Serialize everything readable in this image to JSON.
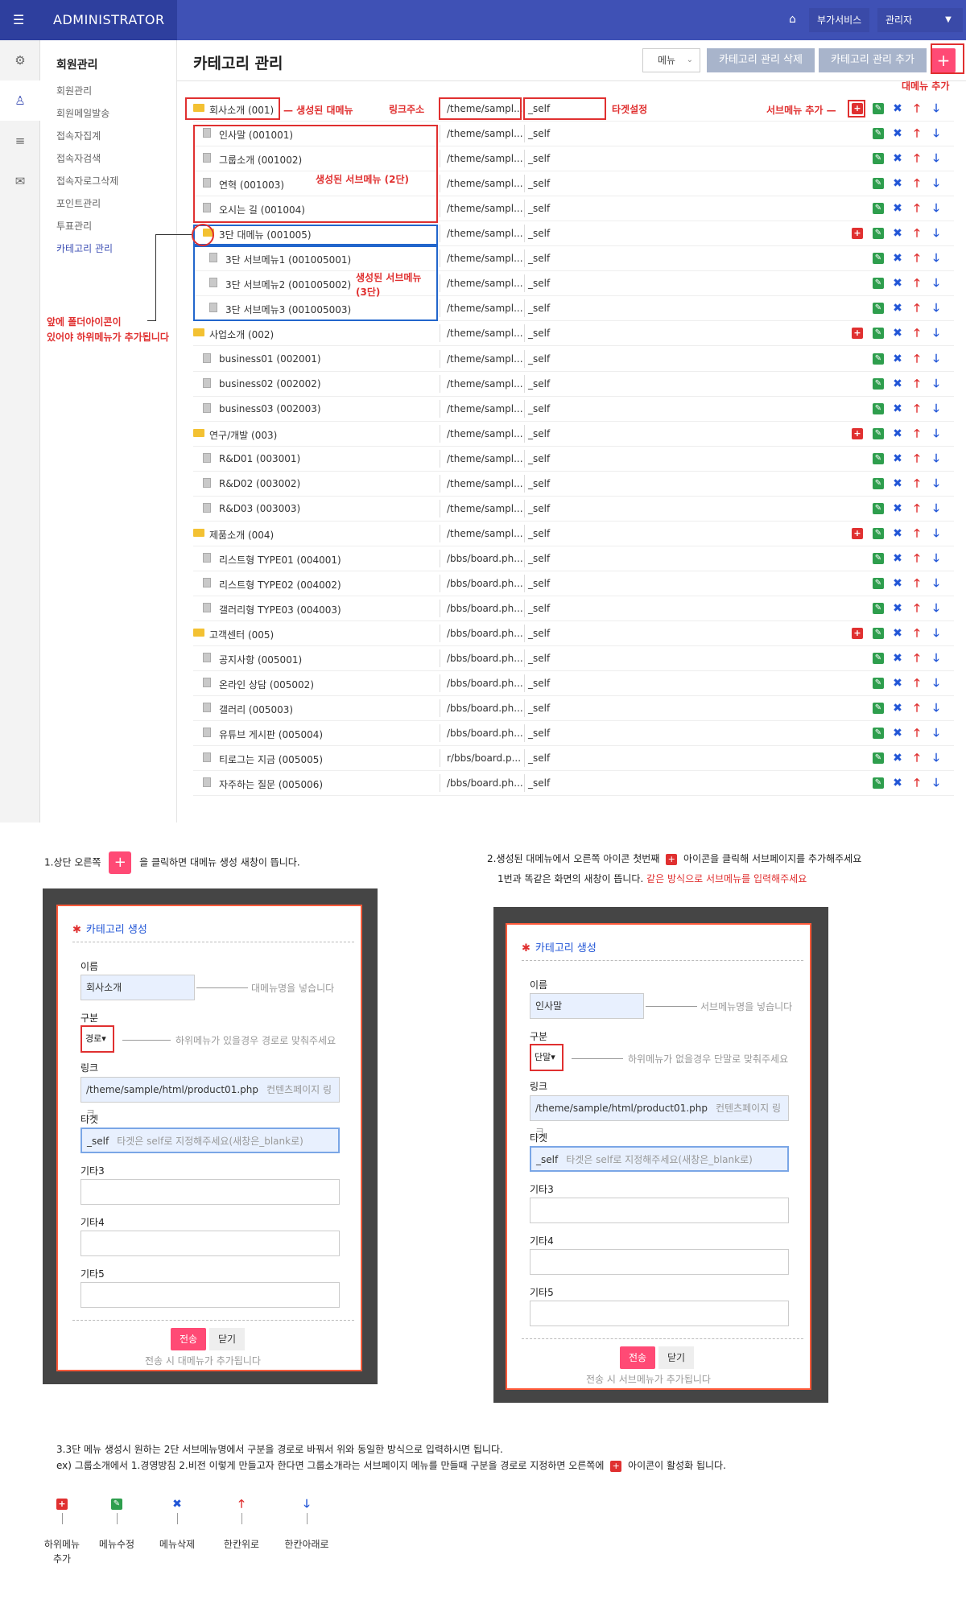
{
  "header": {
    "brand": "ADMINISTRATOR",
    "extra_services": "부가서비스",
    "admin": "관리자",
    "colors": {
      "topbar": "#3f51b5",
      "accent": "#ff4a75"
    }
  },
  "sidebar": {
    "title": "회원관리",
    "items": [
      "회원관리",
      "회원메일발송",
      "접속자집계",
      "접속자검색",
      "접속자로그삭제",
      "포인트관리",
      "투표관리",
      "카테고리 관리"
    ]
  },
  "toolbar": {
    "page_title": "카테고리 관리",
    "menu_select": "메뉴",
    "delete_btn": "카테고리 관리 삭제",
    "add_btn": "카테고리 관리 추가",
    "add_top_icon": "+"
  },
  "annotations": {
    "top_menu_add": "대메뉴 추가",
    "created_main": "— 생성된 대메뉴",
    "link_addr": "링크주소",
    "target_set": "타겟설정",
    "submenu_add": "서브메뉴 추가 —",
    "created_sub2": "생성된 서브메뉴 (2단)",
    "created_sub3": "생성된 서브메뉴\n(3단)",
    "folder_note_1": "앞에 폴더아이콘이",
    "folder_note_2": "있어야 하위메뉴가 추가됩니다"
  },
  "rows": [
    {
      "name": "회사소개 (001)",
      "icon": "folder",
      "indent": 0,
      "link": "/theme/sampl...",
      "target": "_self",
      "plus": true
    },
    {
      "name": "인사말 (001001)",
      "icon": "doc",
      "indent": 1,
      "link": "/theme/sampl...",
      "target": "_self",
      "plus": false
    },
    {
      "name": "그룹소개 (001002)",
      "icon": "doc",
      "indent": 1,
      "link": "/theme/sampl...",
      "target": "_self",
      "plus": false
    },
    {
      "name": "연혁 (001003)",
      "icon": "doc",
      "indent": 1,
      "link": "/theme/sampl...",
      "target": "_self",
      "plus": false
    },
    {
      "name": "오시는 길 (001004)",
      "icon": "doc",
      "indent": 1,
      "link": "/theme/sampl...",
      "target": "_self",
      "plus": false
    },
    {
      "name": "3단 대메뉴 (001005)",
      "icon": "folder",
      "indent": 1,
      "link": "/theme/sampl...",
      "target": "_self",
      "plus": true
    },
    {
      "name": "3단 서브메뉴1 (001005001)",
      "icon": "doc",
      "indent": 2,
      "link": "/theme/sampl...",
      "target": "_self",
      "plus": false
    },
    {
      "name": "3단 서브메뉴2 (001005002)",
      "icon": "doc",
      "indent": 2,
      "link": "/theme/sampl...",
      "target": "_self",
      "plus": false
    },
    {
      "name": "3단 서브메뉴3 (001005003)",
      "icon": "doc",
      "indent": 2,
      "link": "/theme/sampl...",
      "target": "_self",
      "plus": false
    },
    {
      "name": "사업소개 (002)",
      "icon": "folder",
      "indent": 0,
      "link": "/theme/sampl...",
      "target": "_self",
      "plus": true
    },
    {
      "name": "business01 (002001)",
      "icon": "doc",
      "indent": 1,
      "link": "/theme/sampl...",
      "target": "_self",
      "plus": false
    },
    {
      "name": "business02 (002002)",
      "icon": "doc",
      "indent": 1,
      "link": "/theme/sampl...",
      "target": "_self",
      "plus": false
    },
    {
      "name": "business03 (002003)",
      "icon": "doc",
      "indent": 1,
      "link": "/theme/sampl...",
      "target": "_self",
      "plus": false
    },
    {
      "name": "연구/개발 (003)",
      "icon": "folder",
      "indent": 0,
      "link": "/theme/sampl...",
      "target": "_self",
      "plus": true
    },
    {
      "name": "R&D01 (003001)",
      "icon": "doc",
      "indent": 1,
      "link": "/theme/sampl...",
      "target": "_self",
      "plus": false
    },
    {
      "name": "R&D02 (003002)",
      "icon": "doc",
      "indent": 1,
      "link": "/theme/sampl...",
      "target": "_self",
      "plus": false
    },
    {
      "name": "R&D03 (003003)",
      "icon": "doc",
      "indent": 1,
      "link": "/theme/sampl...",
      "target": "_self",
      "plus": false
    },
    {
      "name": "제품소개 (004)",
      "icon": "folder",
      "indent": 0,
      "link": "/theme/sampl...",
      "target": "_self",
      "plus": true
    },
    {
      "name": "리스트형 TYPE01 (004001)",
      "icon": "doc",
      "indent": 1,
      "link": "/bbs/board.ph...",
      "target": "_self",
      "plus": false
    },
    {
      "name": "리스트형 TYPE02 (004002)",
      "icon": "doc",
      "indent": 1,
      "link": "/bbs/board.ph...",
      "target": "_self",
      "plus": false
    },
    {
      "name": "갤러리형 TYPE03 (004003)",
      "icon": "doc",
      "indent": 1,
      "link": "/bbs/board.ph...",
      "target": "_self",
      "plus": false
    },
    {
      "name": "고객센터 (005)",
      "icon": "folder",
      "indent": 0,
      "link": "/bbs/board.ph...",
      "target": "_self",
      "plus": true
    },
    {
      "name": "공지사항 (005001)",
      "icon": "doc",
      "indent": 1,
      "link": "/bbs/board.ph...",
      "target": "_self",
      "plus": false
    },
    {
      "name": "온라인 상담 (005002)",
      "icon": "doc",
      "indent": 1,
      "link": "/bbs/board.ph...",
      "target": "_self",
      "plus": false
    },
    {
      "name": "갤러리 (005003)",
      "icon": "doc",
      "indent": 1,
      "link": "/bbs/board.ph...",
      "target": "_self",
      "plus": false
    },
    {
      "name": "유튜브 게시판 (005004)",
      "icon": "doc",
      "indent": 1,
      "link": "/bbs/board.ph...",
      "target": "_self",
      "plus": false
    },
    {
      "name": "티로그는 지금 (005005)",
      "icon": "doc",
      "indent": 1,
      "link": "r/bbs/board.p...",
      "target": "_self",
      "plus": false
    },
    {
      "name": "자주하는 질문 (005006)",
      "icon": "doc",
      "indent": 1,
      "link": "/bbs/board.ph...",
      "target": "_self",
      "plus": false
    }
  ],
  "guide": {
    "step1_a": "1.상단 오른쪽",
    "step1_b": "을 클릭하면 대메뉴 생성 새창이 뜹니다.",
    "step2_a": "2.생성된 대메뉴에서 오른쪽 아이콘 첫번째",
    "step2_b": "아이콘을 클릭해 서브페이지를 추가해주세요",
    "step2_c": "1번과 똑같은 화면의 새창이 뜹니다.",
    "step2_d": "같은 방식으로 서브메뉴를 입력해주세요",
    "step3_a": "3.3단 메뉴 생성시 원하는 2단 서브메뉴명에서 구분을 경로로 바꿔서 위와 동일한 방식으로 입력하시면 됩니다.",
    "step3_b": "ex) 그룹소개에서 1.경영방침 2.비전 이렇게 만들고자 한다면 그룹소개라는 서브페이지 메뉴를 만들때 구분을 경로로 지정하면 오른쪽에",
    "step3_c": "아이콘이 활성화 됩니다."
  },
  "modal1": {
    "title": "카테고리 생성",
    "name_label": "이름",
    "name_value": "회사소개",
    "name_hint": "대메뉴명을 넣습니다",
    "type_label": "구분",
    "type_value": "경로",
    "type_hint": "하위메뉴가 있을경우 경로로 맞춰주세요",
    "link_label": "링크",
    "link_value": "/theme/sample/html/product01.php",
    "link_hint": "컨텐츠페이지 링크",
    "target_label": "타겟",
    "target_value": "_self",
    "target_hint": "타겟은 self로 지정해주세요(새창은_blank로)",
    "etc3": "기타3",
    "etc4": "기타4",
    "etc5": "기타5",
    "submit": "전송",
    "close": "닫기",
    "note": "전송 시  대메뉴가 추가됩니다"
  },
  "modal2": {
    "title": "카테고리 생성",
    "name_label": "이름",
    "name_value": "인사말",
    "name_hint": "서브메뉴명을 넣습니다",
    "type_label": "구분",
    "type_value": "단말",
    "type_hint": "하위메뉴가 없을경우 단말로 맞춰주세요",
    "link_label": "링크",
    "link_value": "/theme/sample/html/product01.php",
    "link_hint": "컨텐츠페이지 링크",
    "target_label": "타겟",
    "target_value": "_self",
    "target_hint": "타겟은 self로 지정해주세요(새창은_blank로)",
    "etc3": "기타3",
    "etc4": "기타4",
    "etc5": "기타5",
    "submit": "전송",
    "close": "닫기",
    "note": "전송 시  서브메뉴가 추가됩니다"
  },
  "legend": [
    {
      "label": "하위메뉴\n추가",
      "icon": "plus-icon"
    },
    {
      "label": "메뉴수정",
      "icon": "edit-icon"
    },
    {
      "label": "메뉴삭제",
      "icon": "delete-icon"
    },
    {
      "label": "한칸위로",
      "icon": "arrow-up-icon"
    },
    {
      "label": "한칸아래로",
      "icon": "arrow-down-icon"
    }
  ]
}
